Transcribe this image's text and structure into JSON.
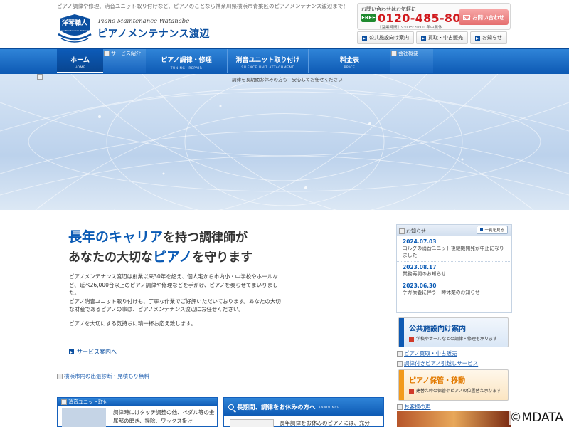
{
  "header": {
    "tagline": "ピアノ調律や修理、消音ユニット取り付けなど、ピアノのことなら神奈川県横浜市青葉区のピアノメンテナンス渡辺まで！",
    "logo_badge_text": "洋琴職人",
    "logo_badge_sub": "Piano Maintenance Watanabe",
    "logo_subtitle": "Piano Maintenance Watanabe",
    "logo_title": "ピアノメンテナンス渡辺"
  },
  "contact": {
    "label": "お問い合わせはお気軽に",
    "free_dial": "FREE",
    "tel": "0120-485-808",
    "hours": "【営業時間】9:00～20:00 年中無休",
    "button": "お問い合わせ"
  },
  "sublinks": [
    {
      "label": "公共施設向け案内"
    },
    {
      "label": "買取・中古販売"
    },
    {
      "label": "お知らせ"
    }
  ],
  "nav": {
    "items": [
      {
        "jp": "ホーム",
        "en": "HOME"
      },
      {
        "jp": "ピアノ調律・修理",
        "en": "TUNING・REPAIR"
      },
      {
        "jp": "消音ユニット取り付け",
        "en": "SILENCE UNIT ATTACHMENT"
      },
      {
        "jp": "料金表",
        "en": "PRICE"
      }
    ],
    "broken_1": "サービス紹介",
    "broken_2": "会社概要"
  },
  "hero": {
    "note": "調律を長期間お休みの方も　安心してお任せください"
  },
  "lead": {
    "line1_a": "長年のキャリア",
    "line1_b": "を持つ調律師が",
    "line2_a": "あなたの大切な",
    "line2_b": "ピアノ",
    "line2_c": "を守ります"
  },
  "body": {
    "p1": "ピアノメンテナンス渡辺は創業以来30年を超え、個人宅から市内小・中学校やホールなど、延べ26,000台以上のピアノ調律や修理などを手がけ、ピアノを奏らせてまいりました。",
    "p2": "ピアノ消音ユニット取り付けも、丁寧な作業でご好評いただいております。あなたの大切な財産であるピアノの事は、ピアノメンテナンス渡辺にお任せください。",
    "p3": "ピアノを大切にする気持ちに精一杯お応え致します。",
    "service_link": "サービス案内へ",
    "visit_link": "横浜市内の出張診断・見積もり無料"
  },
  "box_left": {
    "head_broken": "消音ユニット取付",
    "text": "調律時にはタッチ調整の他、ペダル等の金属部の磨き、掃除、ワックス掛け"
  },
  "box_right": {
    "title": "長期間、調律をお休みの方へ",
    "title_en": "ANNOUNCE",
    "text": "長年調律をお休みのピアノには、充分"
  },
  "news": {
    "head_broken": "お知らせ",
    "all_label": "一覧を見る",
    "items": [
      {
        "date": "2024.07.03",
        "text": "コルグの消音ユニット後継機開発が中止になりました"
      },
      {
        "date": "2023.08.17",
        "text": "業務再開のお知らせ"
      },
      {
        "date": "2023.06.30",
        "text": "ケガ療養に伴う一時休業のお知らせ"
      }
    ]
  },
  "side": {
    "b1_title": "公共施設向け案内",
    "b1_sub": "学校やホールなどの調律・修理も承ります",
    "link1": "ピアノ買取・中古販売",
    "link2": "調律付きピアノ引越しサービス",
    "b2_title": "ピアノ保管・移動",
    "b2_sub": "建替え時の保管やピアノの位置替え承ります",
    "link3": "お客様の声"
  },
  "watermark": "©MDATA",
  "colors": {
    "brand_blue": "#0b4fa0",
    "tel_red": "#d0191d",
    "accent_orange": "#e27a00"
  }
}
